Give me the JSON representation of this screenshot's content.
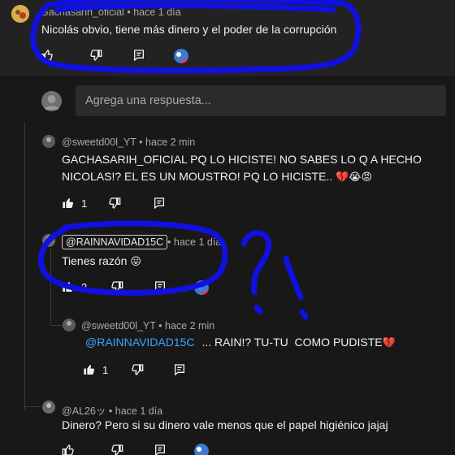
{
  "comment_top": {
    "author": "Gachasarih_oficial",
    "time": "hace 1 día",
    "text": "Nicolás obvio, tiene más dinero y el poder de la corrupción"
  },
  "reply_box": {
    "placeholder": "Agrega una respuesta..."
  },
  "reply1": {
    "author": "@sweetd00l_YT",
    "time": "hace 2 min",
    "line1": "GACHASARIH_OFICIAL PQ LO HICISTE! NO SABES LO Q A HECHO",
    "line2": "NICOLAS!? EL ES UN MOUSTRO! PQ LO HICISTE..",
    "emojis": "💔😭😡",
    "likes": "1"
  },
  "reply2": {
    "author": "@RAINNAVIDAD15C",
    "time": "hace 1 día",
    "text": "Tienes razón",
    "emoji": "😛",
    "likes": "2"
  },
  "reply3": {
    "author": "@sweetd00l_YT",
    "time": "hace 2 min",
    "mention": "@RAINNAVIDAD15C",
    "text": "... RAIN!? TU-TU  COMO PUDISTE",
    "emoji": "💔",
    "likes": "1"
  },
  "reply4": {
    "author": "@AL26ッ",
    "time": "hace 1 día",
    "text": "Dinero? Pero si su dinero vale menos que el papel higiénico jajaj"
  },
  "annotation_color": "#1010e0",
  "separator": "•"
}
